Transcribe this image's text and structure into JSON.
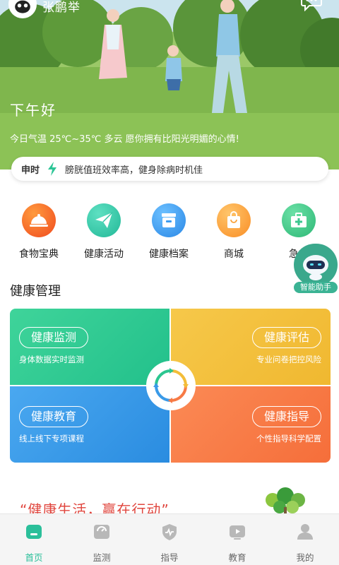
{
  "header": {
    "username": "张鹏举",
    "greeting": "下午好",
    "weather": "今日气温 25℃~35℃  多云  愿你拥有比阳光明媚的心情!"
  },
  "tip": {
    "time": "申时",
    "text": "膀胱值班效率高，健身除病时机佳"
  },
  "quick_links": [
    {
      "label": "食物宝典",
      "icon": "cloche-icon",
      "color": "#f5612a"
    },
    {
      "label": "健康活动",
      "icon": "paper-plane-icon",
      "color": "#34c9a9"
    },
    {
      "label": "健康档案",
      "icon": "file-box-icon",
      "color": "#3d9cf0"
    },
    {
      "label": "商城",
      "icon": "shopping-bag-icon",
      "color": "#fba23a"
    },
    {
      "label": "急救",
      "icon": "first-aid-kit-icon",
      "color": "#3cc68f"
    }
  ],
  "assistant": {
    "label": "智能助手"
  },
  "section": {
    "title": "健康管理"
  },
  "health_tiles": [
    {
      "title": "健康监测",
      "subtitle": "身体数据实时监测",
      "color": "#2cc690"
    },
    {
      "title": "健康评估",
      "subtitle": "专业问卷把控风险",
      "color": "#f3bd39"
    },
    {
      "title": "健康教育",
      "subtitle": "线上线下专项课程",
      "color": "#3a9ae8"
    },
    {
      "title": "健康指导",
      "subtitle": "个性指导科学配置",
      "color": "#f77a45"
    }
  ],
  "slogan": "“健康生活，赢在行动”",
  "tabs": [
    {
      "label": "首页",
      "icon": "home-icon",
      "active": true
    },
    {
      "label": "监测",
      "icon": "monitor-icon",
      "active": false
    },
    {
      "label": "指导",
      "icon": "guide-shield-icon",
      "active": false
    },
    {
      "label": "教育",
      "icon": "video-play-icon",
      "active": false
    },
    {
      "label": "我的",
      "icon": "user-icon",
      "active": false
    }
  ],
  "colors": {
    "accent": "#2bbf9a",
    "slogan": "#e0463e"
  }
}
